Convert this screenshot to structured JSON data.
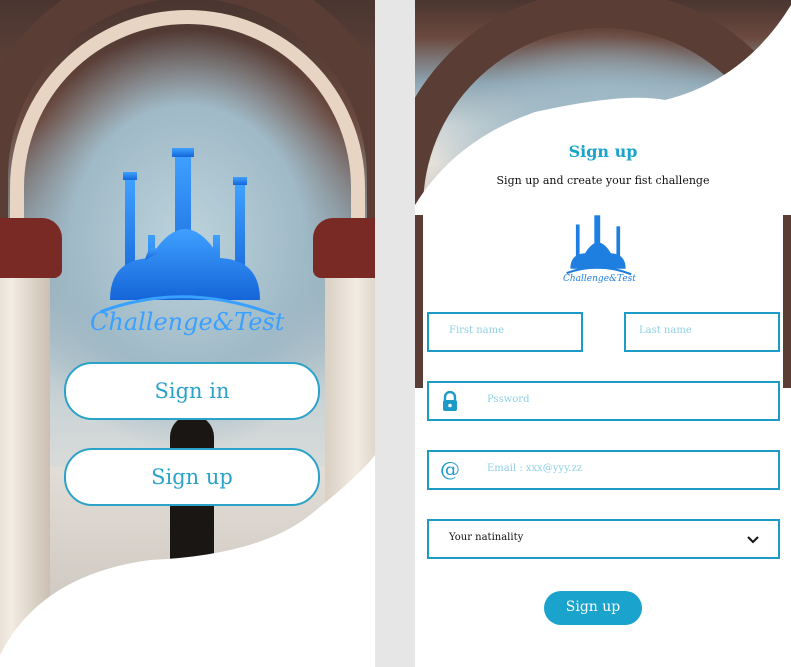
{
  "welcome": {
    "logo_text": "Challenge&Test",
    "signin_label": "Sign in",
    "signup_label": "Sign up"
  },
  "signup": {
    "title": "Sign up",
    "subtitle": "Sign up and create your fist challenge",
    "logo_text": "Challenge&Test",
    "first_name_placeholder": "First name",
    "last_name_placeholder": "Last name",
    "password_placeholder": "Pssword",
    "email_placeholder": "Email : xxx@yyy.zz",
    "nationality_label": "Your natinality",
    "submit_label": "Sign up"
  },
  "icons": {
    "lock": "lock-icon",
    "email": "at-sign-icon",
    "dropdown": "chevron-down-icon"
  },
  "colors": {
    "accent": "#1aa3cc",
    "outline": "#2ba3c8",
    "logo_blue": "#1e7fe0"
  }
}
